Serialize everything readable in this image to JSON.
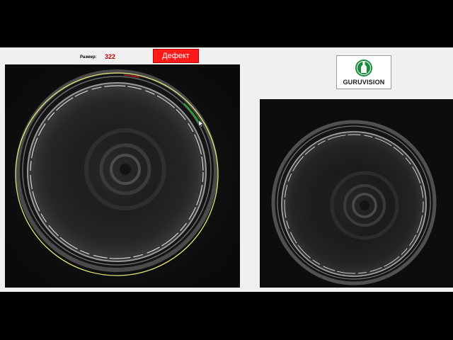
{
  "header": {
    "size_label": "Размер:",
    "size_value": "322",
    "status_label": "Дефект"
  },
  "logo": {
    "text": "GURUVISION",
    "emblem": "bottle-icon"
  },
  "colors": {
    "panel": "#f0f0f0",
    "status_bg": "#ff1a1a",
    "size_value": "#c00000",
    "inspection_ring": "#e4e47a",
    "defect_mark": "#1ea81e",
    "defect_mark_top": "#d02020",
    "logo_green": "#1c8a3c"
  },
  "views": {
    "left": "camera-view-inspected",
    "right": "camera-view-raw"
  }
}
